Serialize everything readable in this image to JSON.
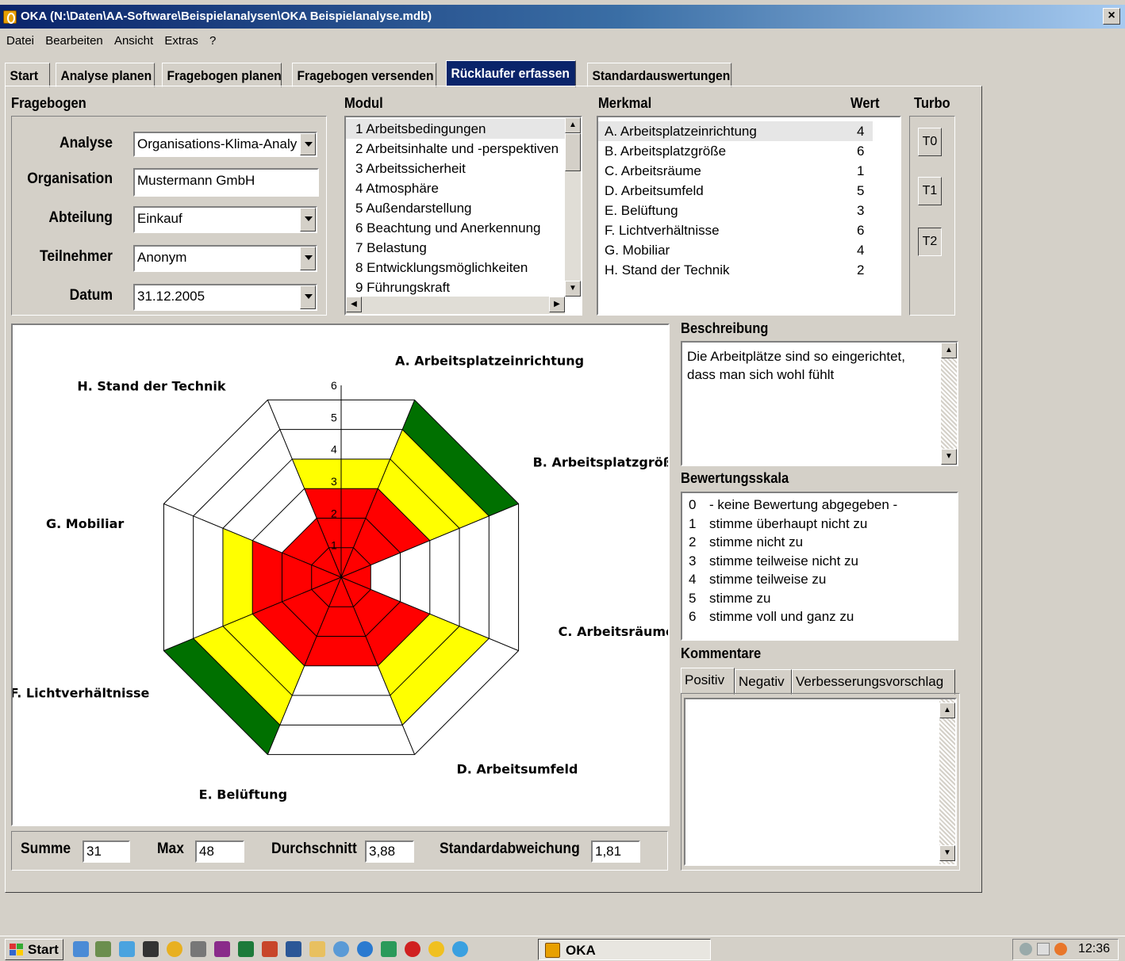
{
  "window": {
    "title": "OKA (N:\\Daten\\AA-Software\\Beispielanalysen\\OKA Beispielanalyse.mdb)",
    "close_label": "×"
  },
  "menu": [
    "Datei",
    "Bearbeiten",
    "Ansicht",
    "Extras",
    "?"
  ],
  "tabs": [
    {
      "label": "Start"
    },
    {
      "label": "Analyse planen"
    },
    {
      "label": "Fragebogen planen"
    },
    {
      "label": "Fragebogen versenden"
    },
    {
      "label": "Rücklaufer erfassen",
      "active": true
    },
    {
      "label": "Standardauswertungen"
    }
  ],
  "fragebogen": {
    "title": "Fragebogen",
    "analyse_label": "Analyse",
    "analyse_value": "Organisations-Klima-Analy",
    "organisation_label": "Organisation",
    "organisation_value": "Mustermann GmbH",
    "abteilung_label": "Abteilung",
    "abteilung_value": "Einkauf",
    "teilnehmer_label": "Teilnehmer",
    "teilnehmer_value": "Anonym",
    "datum_label": "Datum",
    "datum_value": "31.12.2005"
  },
  "modul": {
    "title": "Modul",
    "items": [
      "1  Arbeitsbedingungen",
      "2  Arbeitsinhalte und -perspektiven",
      "3  Arbeitssicherheit",
      "4  Atmosphäre",
      "5  Außendarstellung",
      "6  Beachtung und Anerkennung",
      "7  Belastung",
      "8  Entwicklungsmöglichkeiten",
      "9  Führungskraft"
    ],
    "selected_index": 0
  },
  "merkmal": {
    "title": "Merkmal",
    "wert_title": "Wert",
    "items": [
      {
        "label": "A. Arbeitsplatzeinrichtung",
        "wert": "4"
      },
      {
        "label": "B. Arbeitsplatzgröße",
        "wert": "6"
      },
      {
        "label": "C. Arbeitsräume",
        "wert": "1"
      },
      {
        "label": "D. Arbeitsumfeld",
        "wert": "5"
      },
      {
        "label": "E. Belüftung",
        "wert": "3"
      },
      {
        "label": "F. Lichtverhältnisse",
        "wert": "6"
      },
      {
        "label": "G. Mobiliar",
        "wert": "4"
      },
      {
        "label": "H. Stand der Technik",
        "wert": "2"
      }
    ]
  },
  "turbo": {
    "title": "Turbo",
    "buttons": [
      "T0",
      "T1",
      "T2"
    ]
  },
  "beschreibung": {
    "title": "Beschreibung",
    "text": "Die Arbeitplätze sind so eingerichtet, dass man sich wohl fühlt"
  },
  "bewertungsskala": {
    "title": "Bewertungsskala",
    "items": [
      {
        "num": "0",
        "text": "- keine Bewertung abgegeben -"
      },
      {
        "num": "1",
        "text": "stimme überhaupt nicht zu"
      },
      {
        "num": "2",
        "text": "stimme nicht zu"
      },
      {
        "num": "3",
        "text": "stimme teilweise nicht zu"
      },
      {
        "num": "4",
        "text": "stimme teilweise zu"
      },
      {
        "num": "5",
        "text": "stimme zu"
      },
      {
        "num": "6",
        "text": "stimme voll und ganz zu"
      }
    ]
  },
  "kommentare": {
    "title": "Kommentare",
    "tabs": [
      "Positiv",
      "Negativ",
      "Verbesserungsvorschlag"
    ],
    "text": ""
  },
  "chart_data": {
    "type": "radar",
    "axes": [
      "A. Arbeitsplatzeinrichtung",
      "B. Arbeitsplatzgröße",
      "C. Arbeitsräume",
      "D. Arbeitsumfeld",
      "E. Belüftung",
      "F. Lichtverhältnisse",
      "G. Mobiliar",
      "H. Stand der Technik"
    ],
    "ticks": [
      "1",
      "2",
      "3",
      "4",
      "5",
      "6"
    ],
    "rmax": 6,
    "values": [
      4,
      6,
      1,
      5,
      3,
      6,
      4,
      2
    ],
    "band_colors": {
      "low": "#ff0000",
      "mid": "#ffff00",
      "high": "#007000"
    }
  },
  "stats": {
    "summe_label": "Summe",
    "summe_value": "31",
    "max_label": "Max",
    "max_value": "48",
    "durchschnitt_label": "Durchschnitt",
    "durchschnitt_value": "3,88",
    "std_label": "Standardabweichung",
    "std_value": "1,81"
  },
  "taskbar": {
    "start_label": "Start",
    "task_label": "OKA",
    "clock": "12:36"
  }
}
